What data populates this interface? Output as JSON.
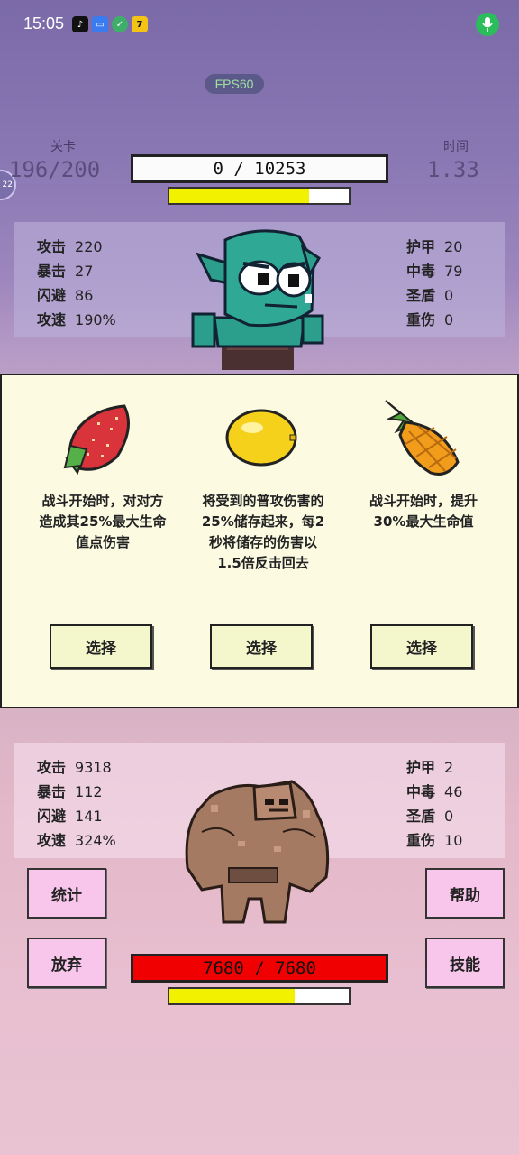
{
  "status_bar": {
    "time": "15:05"
  },
  "fps": "FPS60",
  "side_tab": "22",
  "level": {
    "label": "关卡",
    "value": "196/200"
  },
  "time": {
    "label": "时间",
    "value": "1.33"
  },
  "enemy": {
    "hp_text": "0 / 10253",
    "energy_fraction": 0.78,
    "stats_left": [
      {
        "label": "攻击",
        "value": "220"
      },
      {
        "label": "暴击",
        "value": "27"
      },
      {
        "label": "闪避",
        "value": "86"
      },
      {
        "label": "攻速",
        "value": "190%"
      }
    ],
    "stats_right": [
      {
        "label": "护甲",
        "value": "20"
      },
      {
        "label": "中毒",
        "value": "79"
      },
      {
        "label": "圣盾",
        "value": "0"
      },
      {
        "label": "重伤",
        "value": "0"
      }
    ]
  },
  "choices": [
    {
      "icon": "strawberry-icon",
      "desc": "战斗开始时，对对方造成其25%最大生命值点伤害",
      "button": "选择"
    },
    {
      "icon": "lemon-icon",
      "desc": "将受到的普攻伤害的25%储存起来，每2秒将储存的伤害以1.5倍反击回去",
      "button": "选择"
    },
    {
      "icon": "pineapple-icon",
      "desc": "战斗开始时，提升30%最大生命值",
      "button": "选择"
    }
  ],
  "player": {
    "hp_text": "7680 / 7680",
    "energy_fraction": 0.7,
    "stats_left": [
      {
        "label": "攻击",
        "value": "9318"
      },
      {
        "label": "暴击",
        "value": "112"
      },
      {
        "label": "闪避",
        "value": "141"
      },
      {
        "label": "攻速",
        "value": "324%"
      }
    ],
    "stats_right": [
      {
        "label": "护甲",
        "value": "2"
      },
      {
        "label": "中毒",
        "value": "46"
      },
      {
        "label": "圣盾",
        "value": "0"
      },
      {
        "label": "重伤",
        "value": "10"
      }
    ]
  },
  "buttons": {
    "stats": "统计",
    "help": "帮助",
    "give_up": "放弃",
    "skills": "技能"
  },
  "colors": {
    "player_hp": "#f00000",
    "energy": "#f2f200",
    "card_bg": "#fcfbe2",
    "side_button": "#f7c6ea"
  }
}
